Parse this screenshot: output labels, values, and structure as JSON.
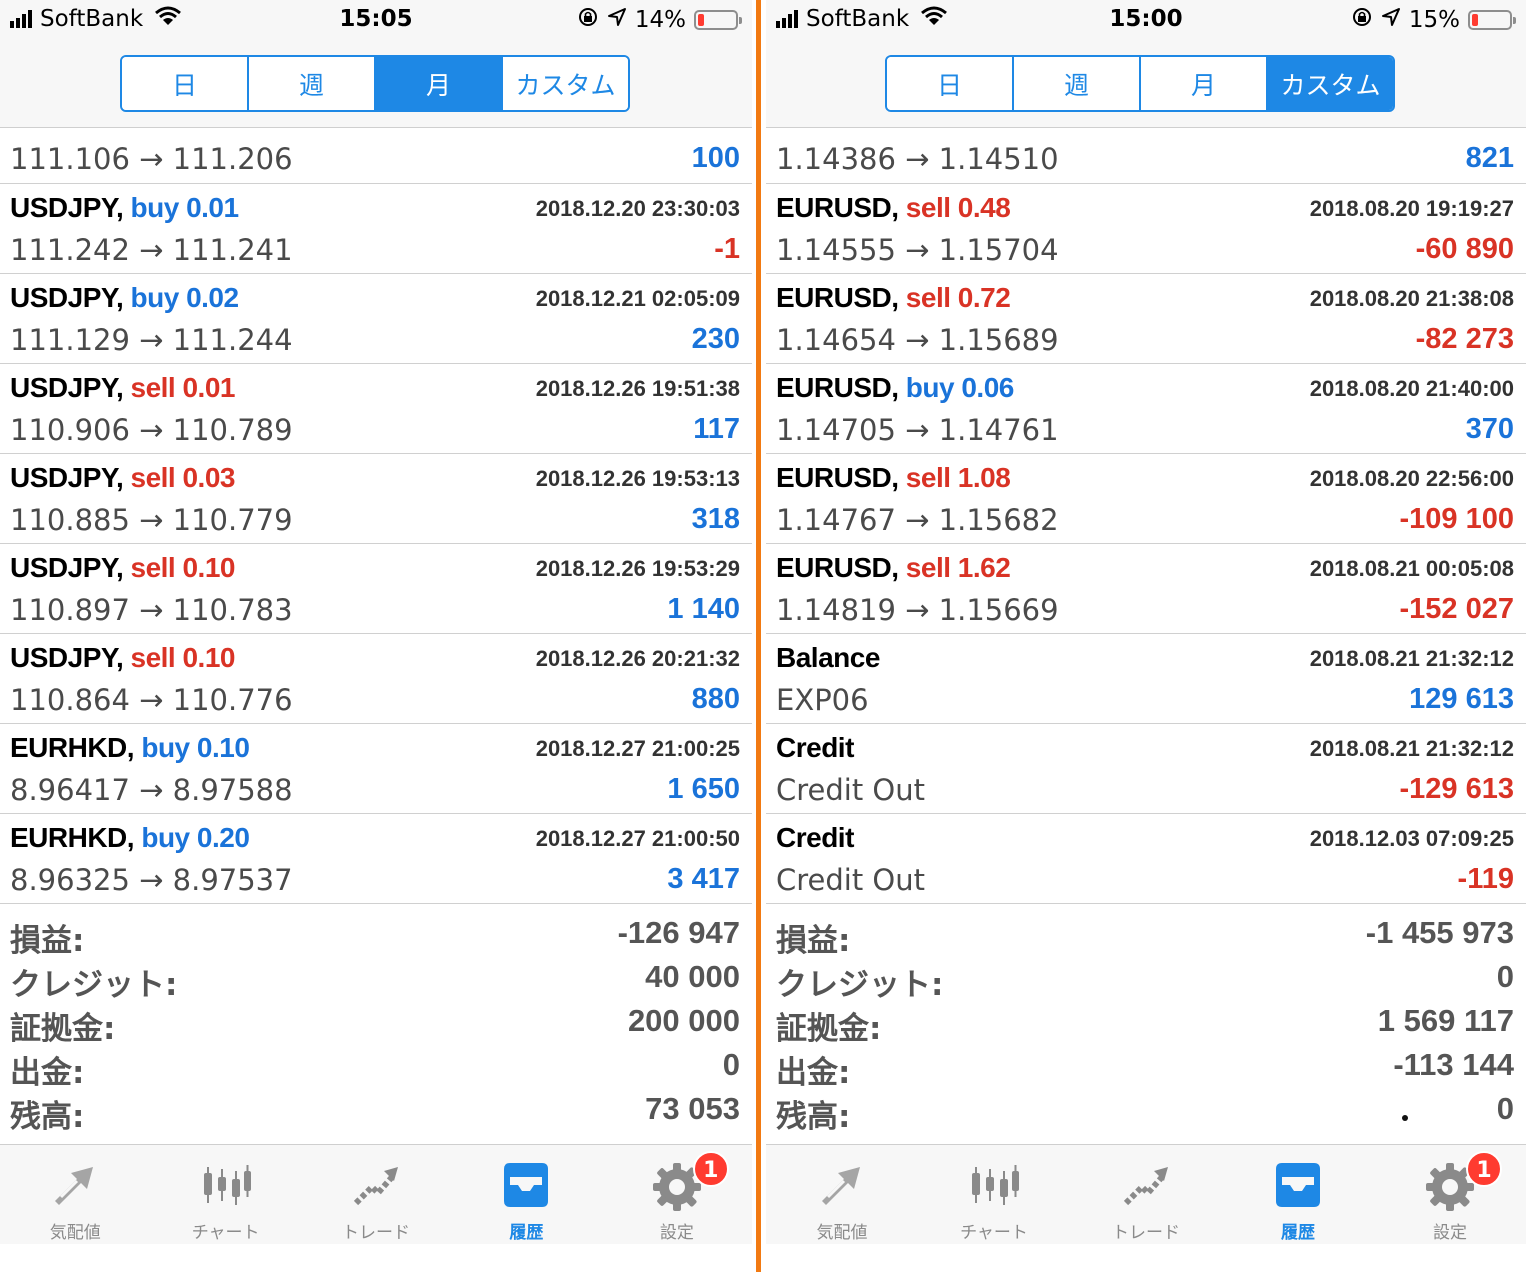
{
  "left": {
    "status": {
      "carrier": "SoftBank",
      "time": "15:05",
      "battery": "14%",
      "battery_level": 0.14
    },
    "tabs": [
      "日",
      "週",
      "月",
      "カスタム"
    ],
    "active_tab": 2,
    "partial_row": {
      "price": "111.106 → 111.206",
      "profit": "100"
    },
    "rows": [
      {
        "symbol": "USDJPY,",
        "side": "buy",
        "volume": "0.01",
        "time": "2018.12.20 23:30:03",
        "price": "111.242 → 111.241",
        "profit": "-1"
      },
      {
        "symbol": "USDJPY,",
        "side": "buy",
        "volume": "0.02",
        "time": "2018.12.21 02:05:09",
        "price": "111.129 → 111.244",
        "profit": "230"
      },
      {
        "symbol": "USDJPY,",
        "side": "sell",
        "volume": "0.01",
        "time": "2018.12.26 19:51:38",
        "price": "110.906 → 110.789",
        "profit": "117"
      },
      {
        "symbol": "USDJPY,",
        "side": "sell",
        "volume": "0.03",
        "time": "2018.12.26 19:53:13",
        "price": "110.885 → 110.779",
        "profit": "318"
      },
      {
        "symbol": "USDJPY,",
        "side": "sell",
        "volume": "0.10",
        "time": "2018.12.26 19:53:29",
        "price": "110.897 → 110.783",
        "profit": "1 140"
      },
      {
        "symbol": "USDJPY,",
        "side": "sell",
        "volume": "0.10",
        "time": "2018.12.26 20:21:32",
        "price": "110.864 → 110.776",
        "profit": "880"
      },
      {
        "symbol": "EURHKD,",
        "side": "buy",
        "volume": "0.10",
        "time": "2018.12.27 21:00:25",
        "price": "8.96417 → 8.97588",
        "profit": "1 650"
      },
      {
        "symbol": "EURHKD,",
        "side": "buy",
        "volume": "0.20",
        "time": "2018.12.27 21:00:50",
        "price": "8.96325 → 8.97537",
        "profit": "3 417"
      }
    ],
    "summary": [
      {
        "label": "損益:",
        "value": "-126 947"
      },
      {
        "label": "クレジット:",
        "value": "40 000"
      },
      {
        "label": "証拠金:",
        "value": "200 000"
      },
      {
        "label": "出金:",
        "value": "0"
      },
      {
        "label": "残高:",
        "value": "73 053"
      }
    ]
  },
  "right": {
    "status": {
      "carrier": "SoftBank",
      "time": "15:00",
      "battery": "15%",
      "battery_level": 0.15
    },
    "tabs": [
      "日",
      "週",
      "月",
      "カスタム"
    ],
    "active_tab": 3,
    "partial_row": {
      "price": "1.14386 → 1.14510",
      "profit": "821"
    },
    "rows": [
      {
        "symbol": "EURUSD,",
        "side": "sell",
        "volume": "0.48",
        "time": "2018.08.20 19:19:27",
        "price": "1.14555 → 1.15704",
        "profit": "-60 890"
      },
      {
        "symbol": "EURUSD,",
        "side": "sell",
        "volume": "0.72",
        "time": "2018.08.20 21:38:08",
        "price": "1.14654 → 1.15689",
        "profit": "-82 273"
      },
      {
        "symbol": "EURUSD,",
        "side": "buy",
        "volume": "0.06",
        "time": "2018.08.20 21:40:00",
        "price": "1.14705 → 1.14761",
        "profit": "370"
      },
      {
        "symbol": "EURUSD,",
        "side": "sell",
        "volume": "1.08",
        "time": "2018.08.20 22:56:00",
        "price": "1.14767 → 1.15682",
        "profit": "-109 100"
      },
      {
        "symbol": "EURUSD,",
        "side": "sell",
        "volume": "1.62",
        "time": "2018.08.21 00:05:08",
        "price": "1.14819 → 1.15669",
        "profit": "-152 027"
      },
      {
        "symbol": "Balance",
        "side": "",
        "volume": "",
        "time": "2018.08.21 21:32:12",
        "price": "EXP06",
        "profit": "129 613"
      },
      {
        "symbol": "Credit",
        "side": "",
        "volume": "",
        "time": "2018.08.21 21:32:12",
        "price": "Credit Out",
        "profit": "-129 613"
      },
      {
        "symbol": "Credit",
        "side": "",
        "volume": "",
        "time": "2018.12.03 07:09:25",
        "price": "Credit Out",
        "profit": "-119"
      }
    ],
    "summary": [
      {
        "label": "損益:",
        "value": "-1 455 973"
      },
      {
        "label": "クレジット:",
        "value": "0"
      },
      {
        "label": "証拠金:",
        "value": "1 569 117"
      },
      {
        "label": "出金:",
        "value": "-113 144"
      },
      {
        "label": "残高:",
        "value": "0"
      }
    ]
  },
  "tabbar": [
    {
      "label": "気配値",
      "icon": "quotes-icon"
    },
    {
      "label": "チャート",
      "icon": "chart-icon"
    },
    {
      "label": "トレード",
      "icon": "trade-icon"
    },
    {
      "label": "履歴",
      "icon": "history-icon"
    },
    {
      "label": "設定",
      "icon": "settings-icon",
      "badge": "1"
    }
  ],
  "active_tabbar": 3,
  "colors": {
    "accent": "#1e88e5",
    "buy": "#1a73d9",
    "sell": "#d93325",
    "divider": "#f27a12"
  }
}
